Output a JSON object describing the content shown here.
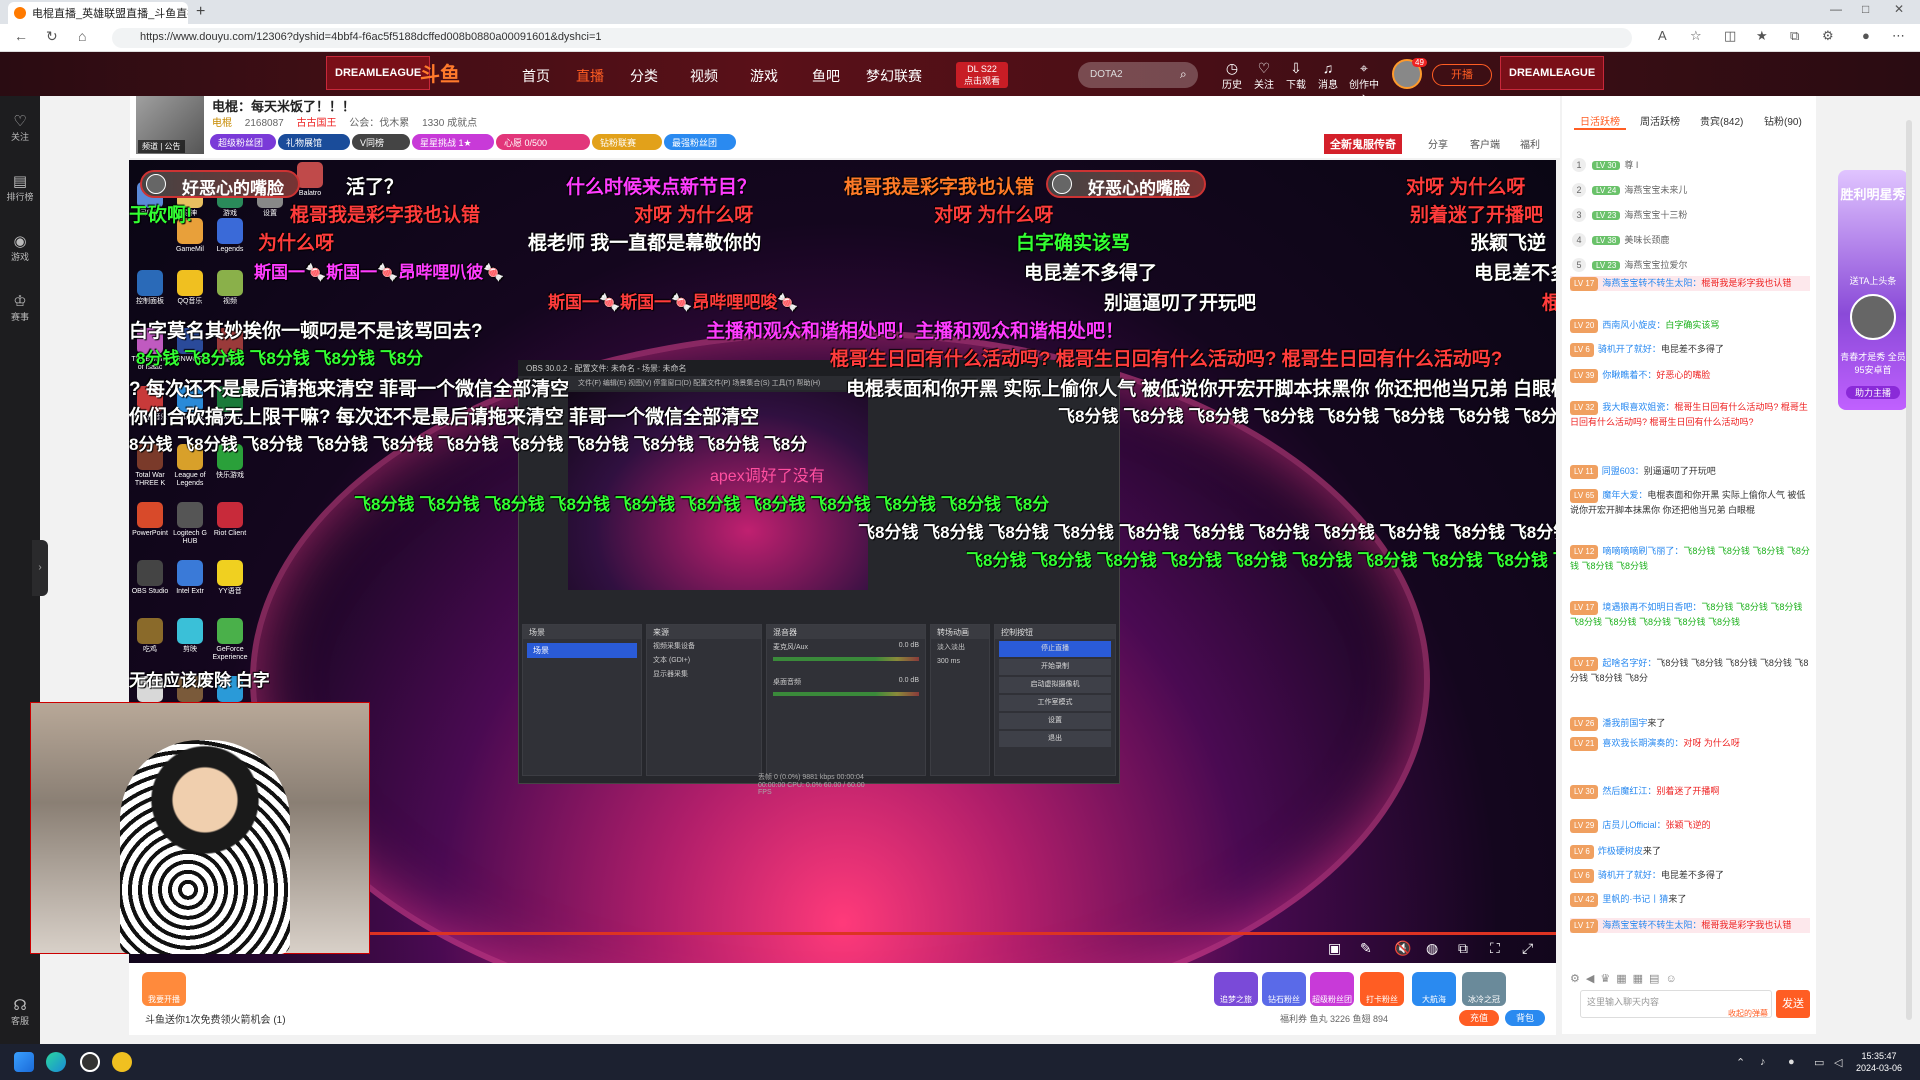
{
  "browser": {
    "tab_title": "电棍直播_英雄联盟直播_斗鱼直播",
    "new_tab": "+",
    "url": "https://www.douyu.com/12306?dyshid=4bbf4-f6ac5f5188dcffed008b0880a00091601&dyshci=1"
  },
  "header": {
    "logo_text": "斗鱼",
    "left_badge": "DREAMLEAGUE",
    "right_badge": "DREAMLEAGUE",
    "nav": [
      "首页",
      "直播",
      "分类",
      "视频",
      "游戏",
      "鱼吧",
      "梦幻联赛"
    ],
    "dl_badge": {
      "line1": "DL S22",
      "line2": "点击观看"
    },
    "search_placeholder": "DOTA2",
    "icons": [
      {
        "label": "历史",
        "icon": "history-icon"
      },
      {
        "label": "关注",
        "icon": "heart-icon"
      },
      {
        "label": "下载",
        "icon": "download-icon"
      },
      {
        "label": "消息",
        "icon": "bell-icon"
      },
      {
        "label": "创作中心",
        "icon": "location-icon"
      }
    ],
    "avatar_badge": "49",
    "start_stream": "开播"
  },
  "leftnav": [
    {
      "label": "关注",
      "icon": "heart-icon"
    },
    {
      "label": "排行榜",
      "icon": "ranking-icon"
    },
    {
      "label": "游戏",
      "icon": "gamepad-icon"
    },
    {
      "label": "赛事",
      "icon": "trophy-icon"
    },
    {
      "label": "客服",
      "icon": "headset-icon"
    }
  ],
  "room": {
    "title": "电棍：每天米饭了！！！",
    "category": "电棍",
    "heat": "2168087",
    "tag": "古古国王",
    "guild": "公会：伐木累",
    "fans": "1330 成就点",
    "under_avatar": "频道 | 公告",
    "pills": [
      {
        "text": "超级粉丝团",
        "color": "#7a3ad8"
      },
      {
        "text": "礼物展馆",
        "color": "#1a4c9a"
      },
      {
        "text": "V同榜",
        "color": "#444444"
      },
      {
        "text": "星星挑战 1★",
        "color": "#c83ad8"
      },
      {
        "text": "心愿 0/500",
        "color": "#e2367a"
      },
      {
        "text": "钻粉联赛",
        "color": "#e2a11a"
      },
      {
        "text": "最强粉丝团",
        "color": "#2a8af0"
      }
    ],
    "event": "全新鬼服传奇",
    "share": "分享",
    "client": "客户端",
    "welfare": "福利"
  },
  "danmaku": [
    {
      "text": "活了？",
      "cls": "c-w"
    },
    {
      "text": "什么时候来点新节目？",
      "cls": "c-m"
    },
    {
      "text": "棍哥我是彩字我也认错",
      "cls": "c-o"
    },
    {
      "text": "对呀 为什么呀",
      "cls": "c-r"
    },
    {
      "text": "于砍啊!",
      "cls": "c-g"
    },
    {
      "text": "棍哥我是彩字我也认错",
      "cls": "c-r"
    },
    {
      "text": "对呀 为什么呀",
      "cls": "c-r"
    },
    {
      "text": "对呀 为什么呀",
      "cls": "c-r"
    },
    {
      "text": "别着迷了开播吧",
      "cls": "c-r"
    },
    {
      "text": "为什么呀",
      "cls": "c-r"
    },
    {
      "text": "棍老师 我一直都是幕敬你的",
      "cls": "c-w"
    },
    {
      "text": "白字确实该骂",
      "cls": "c-g"
    },
    {
      "text": "张颖飞逆",
      "cls": "c-w"
    },
    {
      "text": "斯国一🍬斯国一🍬昂哔哩叭彼🍬",
      "cls": "c-m"
    },
    {
      "text": "电昆差不多得了",
      "cls": "c-w"
    },
    {
      "text": "电昆差不多",
      "cls": "c-w"
    },
    {
      "text": "斯国一🍬斯国一🍬昂哔哩吧唆🍬",
      "cls": "c-r"
    },
    {
      "text": "别逼逼叨了开玩吧",
      "cls": "c-w"
    },
    {
      "text": "棍",
      "cls": "c-r"
    },
    {
      "text": "白字莫名其妙挨你一顿叼是不是该骂回去?",
      "cls": "c-w"
    },
    {
      "text": "主播和观众和谐相处吧！主播和观众和谐相处吧！",
      "cls": "c-m"
    },
    {
      "text": "8分钱 飞8分钱 飞8分钱 飞8分钱 飞8分",
      "cls": "c-g"
    },
    {
      "text": "棍哥生日回有什么活动吗? 棍哥生日回有什么活动吗? 棍哥生日回有什么活动吗?",
      "cls": "c-r"
    },
    {
      "text": "? 每次还不是最后请拖来清空 菲哥一个微信全部清空",
      "cls": "c-w"
    },
    {
      "text": "电棍表面和你开黑 实际上偷你人气 被低说你开宏开脚本抹黑你 你还把他当兄弟 白眼棍",
      "cls": "c-w"
    },
    {
      "text": "你们合砍搞无上限干嘛? 每次还不是最后请拖来清空 菲哥一个微信全部清空",
      "cls": "c-w"
    },
    {
      "text": "飞8分钱 飞8分钱 飞8分钱 飞8分钱 飞8分钱 飞8分钱 飞8分钱 飞8分钱 飞8分钱",
      "cls": "c-w"
    },
    {
      "text": "8分钱 飞8分钱 飞8分钱 飞8分钱 飞8分钱 飞8分钱 飞8分钱 飞8分钱 飞8分钱 飞8分钱 飞8分",
      "cls": "c-w"
    },
    {
      "text": "飞8分钱 飞8分钱 飞8分钱 飞8分钱 飞8分钱 飞8分钱 飞8分钱 飞8分钱 飞8分钱 飞8分钱 飞8分",
      "cls": "c-g"
    },
    {
      "text": "飞8分钱 飞8分钱 飞8分钱 飞8分钱 飞8分钱 飞8分钱 飞8分钱 飞8分钱 飞8分钱 飞8分钱 飞8分钱 飞8分钱 飞8分",
      "cls": "c-w"
    },
    {
      "text": "飞8分钱 飞8分钱 飞8分钱 飞8分钱 飞8分钱 飞8分钱 飞8分钱 飞8分钱 飞8分钱 飞8分钱 飞8分钱 飞8分",
      "cls": "c-g"
    },
    {
      "text": "无在应该废除 白字",
      "cls": "c-w"
    }
  ],
  "dm_pills": [
    "好恶心的嘴脸",
    "好恶心的嘴脸"
  ],
  "desktop_icons": [
    "回收站",
    "原神",
    "游戏",
    "设置",
    "Balatro",
    "GameMil",
    "Legends",
    "控制面板",
    "QQ音乐",
    "视频",
    "The Binding of Isaac",
    "WINWORD",
    "雀魂",
    "网易云音乐",
    "腾讯会议",
    "EXCEL",
    "Total War THREE K",
    "League of Legends",
    "快乐游戏",
    "PowerPoint",
    "Logitech G HUB",
    "Riot Client",
    "OBS Studio",
    "Intel Extr",
    "YY语音",
    "吃鸡",
    "剪映",
    "GeForce Experience",
    "Goose",
    "Goose Duck",
    "ToDesk"
  ],
  "obs": {
    "title": "OBS 30.0.2 - 配置文件: 未命名 - 场景: 未命名",
    "menu": "文件(F)  编辑(E)  视图(V)  停靠窗口(D)  配置文件(P)  场景集合(S)  工具(T)  帮助(H)",
    "preview_text": "apex调好了没有",
    "panels": [
      "场景",
      "来源",
      "混音器",
      "转场动画",
      "控制按钮"
    ],
    "scene": "场景",
    "sources": [
      "视频采集设备",
      "文本 (GDI+)",
      "显示器采集"
    ],
    "mixer": [
      "麦克风/Aux",
      "桌面音频"
    ],
    "mixer_db": [
      "0.0 dB",
      "0.0 dB"
    ],
    "transition": "淡入淡出",
    "duration": "300 ms",
    "controls": [
      "停止直播",
      "开始录制",
      "启动虚拟摄像机",
      "工作室模式",
      "设置",
      "退出"
    ],
    "status": "丢帧 0 (0.0%)   9881 kbps   00:00:04   00:00:00   CPU: 0.0%   60.00 / 60.00 FPS"
  },
  "below": {
    "gifts": [
      {
        "name": "我要开播",
        "color": "#ff8a3c"
      },
      {
        "name": "追梦之旅",
        "color": "#7a4ad8"
      },
      {
        "name": "钻石粉丝",
        "color": "#5a6ae8"
      },
      {
        "name": "超级粉丝团",
        "color": "#c83ad8"
      },
      {
        "name": "打卡粉丝",
        "color": "#ff5d23"
      },
      {
        "name": "大航海",
        "color": "#2a8af0"
      },
      {
        "name": "冰冷之冠",
        "color": "#6a8a9a"
      }
    ],
    "free_gift": "斗鱼送你1次免费领火箭机会 (1)",
    "stats": "福利券   鱼丸 3226   鱼翅 894",
    "recharge": "充值",
    "backpack": "背包"
  },
  "rpanel": {
    "tabs": [
      "日活跃榜",
      "周活跃榜",
      "贵宾(842)",
      "钻粉(90)"
    ],
    "ranks": [
      {
        "n": "1",
        "lv": "LV 30",
        "name": "尊 I",
        "lvcolor": "#6ac26a"
      },
      {
        "n": "2",
        "lv": "LV 24",
        "name": "海燕宝宝未来儿",
        "lvcolor": "#6ac26a"
      },
      {
        "n": "3",
        "lv": "LV 23",
        "name": "海燕宝宝十三粉",
        "lvcolor": "#6ac26a"
      },
      {
        "n": "4",
        "lv": "LV 38",
        "name": "美味长颈鹿",
        "lvcolor": "#6ac26a"
      },
      {
        "n": "5",
        "lv": "LV 23",
        "name": "海燕宝宝拉爱尔",
        "lvcolor": "#6ac26a"
      }
    ],
    "chats": [
      {
        "lv": "LV 17",
        "user": "海燕宝宝转不转生太阳：",
        "msg": "棍哥我是彩字我也认错",
        "hl": true,
        "cls": "rd"
      },
      {
        "lv": "LV 20",
        "user": "西南风小旋皮：",
        "msg": "白字确实该骂",
        "hl": false,
        "cls": "g"
      },
      {
        "lv": "LV 6",
        "user": "骑机开了就好：",
        "msg": "电昆差不多得了",
        "hl": false,
        "cls": ""
      },
      {
        "lv": "LV 39",
        "user": "你瞅瞧着不：",
        "msg": "好恶心的嘴脸",
        "hl": false,
        "cls": "rd"
      },
      {
        "lv": "LV 32",
        "user": "我大眼喜欢姐瓷：",
        "msg": "棍哥生日回有什么活动吗? 棍哥生日回有什么活动吗? 棍哥生日回有什么活动吗?",
        "hl": false,
        "cls": "rd"
      },
      {
        "lv": "LV 11",
        "user": "同盟603：",
        "msg": "别逼逼叨了开玩吧",
        "hl": false,
        "cls": ""
      },
      {
        "lv": "LV 65",
        "user": "魔年大爱：",
        "msg": "电棍表面和你开黑 实际上偷你人气 被低说你开宏开脚本抹黑你 你还把他当兄弟 白眼棍",
        "hl": false,
        "cls": ""
      },
      {
        "lv": "LV 12",
        "user": "嘀嘀嘀嘀刷飞丽了：",
        "msg": "飞8分钱 飞8分钱 飞8分钱 飞8分钱 飞8分钱 飞8分钱",
        "hl": false,
        "cls": "g"
      },
      {
        "lv": "LV 17",
        "user": "境遇狼再不如明日香吧：",
        "msg": "飞8分钱 飞8分钱 飞8分钱 飞8分钱 飞8分钱 飞8分钱 飞8分钱 飞8分钱",
        "hl": false,
        "cls": "g"
      },
      {
        "lv": "LV 17",
        "user": "起啥名字好：",
        "msg": "飞8分钱 飞8分钱 飞8分钱 飞8分钱 飞8分钱 飞8分钱 飞8分",
        "hl": false,
        "cls": ""
      },
      {
        "lv": "LV 26",
        "user": "潘我前国宇",
        "msg": "来了",
        "hl": false,
        "cls": ""
      },
      {
        "lv": "LV 21",
        "user": "喜欢我长期演奏的：",
        "msg": "对呀 为什么呀",
        "hl": false,
        "cls": "rd"
      },
      {
        "lv": "LV 30",
        "user": "然后魔红江：",
        "msg": "别着迷了开播啊",
        "hl": false,
        "cls": "rd"
      },
      {
        "lv": "LV 29",
        "user": "店员儿Official：",
        "msg": "张颖飞逆的",
        "hl": false,
        "cls": "rd"
      },
      {
        "lv": "LV 6",
        "user": "炸极硬树皮",
        "msg": "来了",
        "hl": false,
        "cls": ""
      },
      {
        "lv": "LV 6",
        "user": "骑机开了就好：",
        "msg": "电昆差不多得了",
        "hl": false,
        "cls": ""
      },
      {
        "lv": "LV 42",
        "user": "里帆的·书记丨猜",
        "msg": "来了",
        "hl": false,
        "cls": ""
      },
      {
        "lv": "LV 17",
        "user": "海燕宝宝转不转生太阳：",
        "msg": "棍哥我是彩字我也认错",
        "hl": true,
        "cls": "rd"
      }
    ],
    "input_placeholder": "这里输入聊天内容",
    "send": "发送",
    "receive": "收起的弹幕"
  },
  "right_ad": {
    "line1": "胜利明星秀",
    "line2": "送TA上头条",
    "line3": "青春才是秀 全员95安卓首",
    "line4": "助力主播"
  },
  "taskbar": {
    "time": "15:35:47",
    "date": "2024-03-06"
  }
}
